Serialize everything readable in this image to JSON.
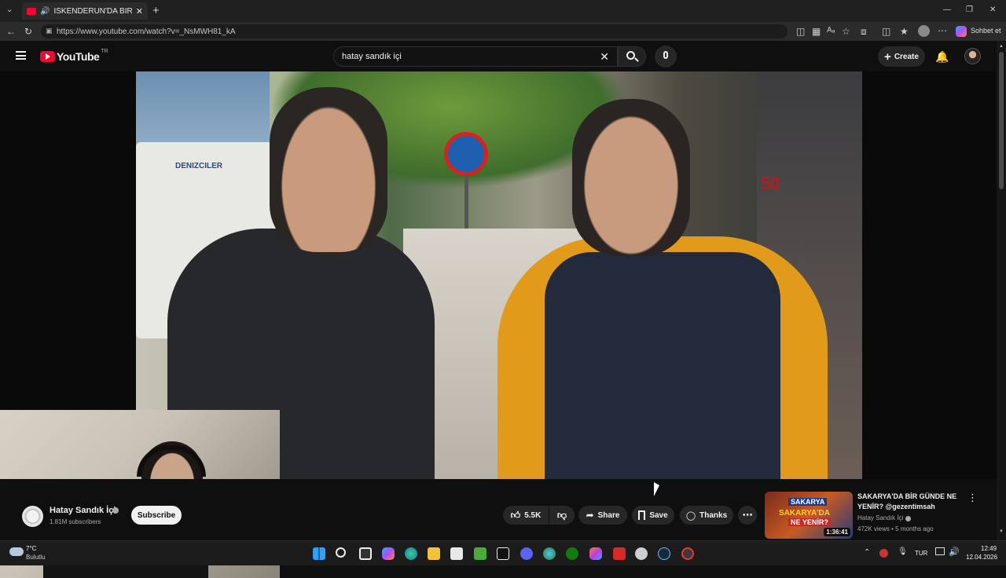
{
  "browser": {
    "tab_title": "İSKENDERUN'DA BİR GÜNDE",
    "url": "https://www.youtube.com/watch?v=_NsMWH81_kA",
    "copilot_label": "Sohbet et"
  },
  "youtube": {
    "logo": "YouTube",
    "region": "TR",
    "search_value": "hatay sandık içi",
    "create_label": "Create"
  },
  "video": {
    "scene_signs": [
      "DENIZCILER",
      "50"
    ]
  },
  "channel": {
    "name": "Hatay Sandık İçi",
    "subscribers": "1.81M subscribers",
    "subscribe_label": "Subscribe"
  },
  "actions": {
    "likes": "5.5K",
    "share": "Share",
    "save": "Save",
    "thanks": "Thanks"
  },
  "recommendation": {
    "title": "SAKARYA'DA BİR GÜNDE NE YENİR? @gezentimsah",
    "channel": "Hatay Sandık İçi",
    "meta": "472K views • 5 months ago",
    "duration": "1:36:41",
    "thumb_text_1": "SAKARYA",
    "thumb_text_2": "SAKARYA'DA",
    "thumb_text_3": "NE YENİR?"
  },
  "taskbar": {
    "temp": "7°C",
    "weather": "Bulutlu",
    "lang": "TUR",
    "time": "12:49",
    "date": "12.04.2026"
  },
  "colors": {
    "accent_red": "#ff0033",
    "bg": "#0f0f0f"
  }
}
